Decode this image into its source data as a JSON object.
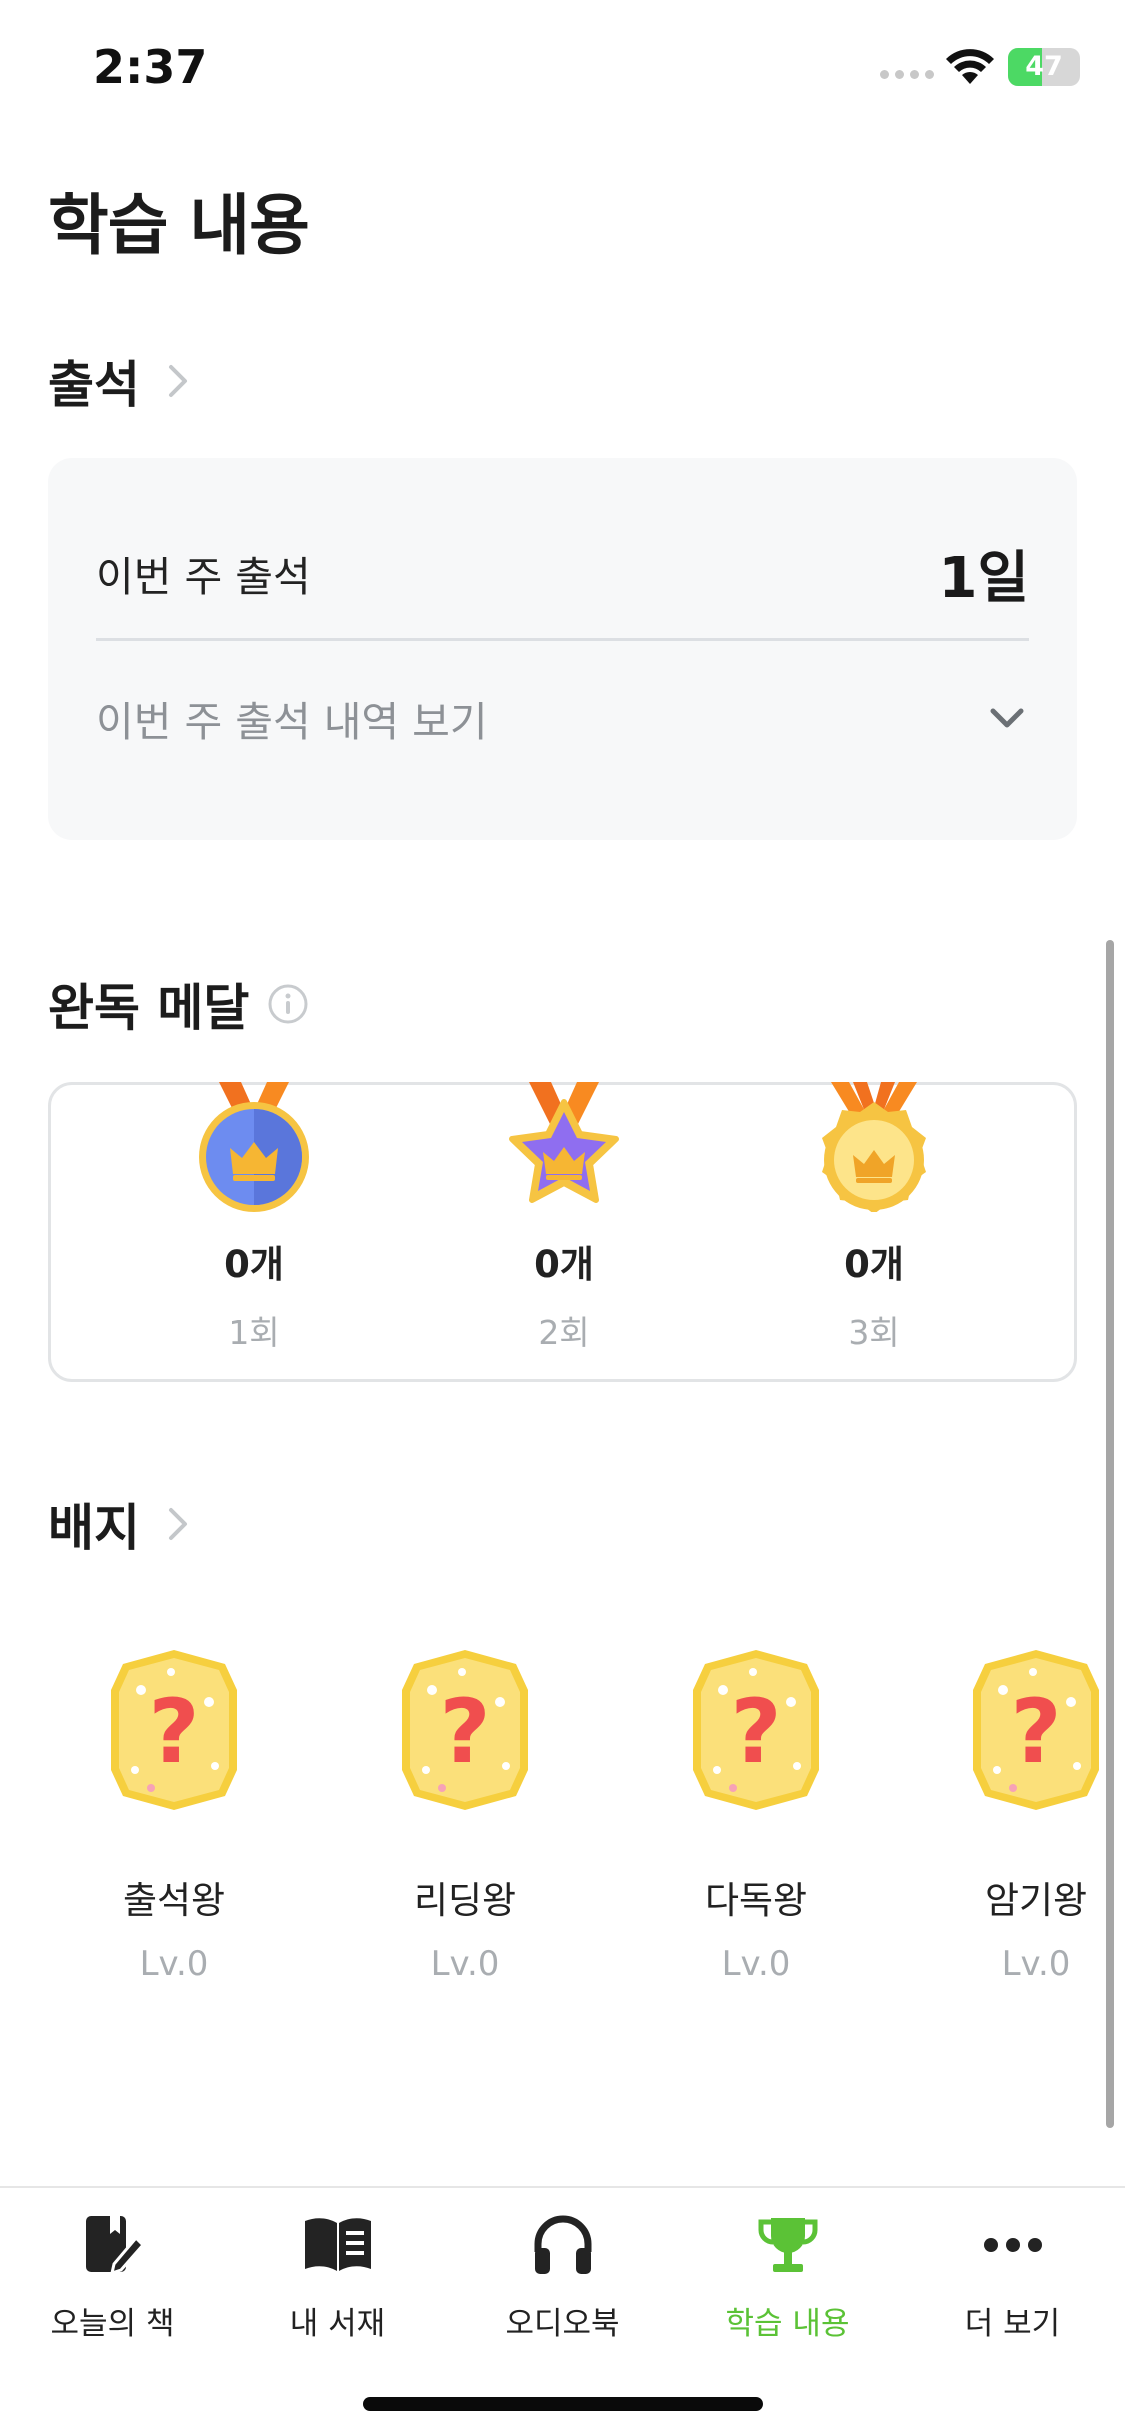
{
  "status_bar": {
    "time": "2:37",
    "battery": "47",
    "battery_level_percent": 47
  },
  "page": {
    "title": "학습 내용"
  },
  "attendance": {
    "section_title": "출석",
    "week_label": "이번 주 출석",
    "week_value": "1일",
    "history_label": "이번 주 출석 내역 보기"
  },
  "medals": {
    "section_title": "완독 메달",
    "items": [
      {
        "count": "0개",
        "label": "1회",
        "icon": "blue-crown-medal-icon"
      },
      {
        "count": "0개",
        "label": "2회",
        "icon": "purple-star-crown-medal-icon"
      },
      {
        "count": "0개",
        "label": "3회",
        "icon": "gold-crown-medal-icon"
      }
    ]
  },
  "badges": {
    "section_title": "배지",
    "items": [
      {
        "name": "출석왕",
        "level": "Lv.0"
      },
      {
        "name": "리딩왕",
        "level": "Lv.0"
      },
      {
        "name": "다독왕",
        "level": "Lv.0"
      },
      {
        "name": "암기왕",
        "level": "Lv.0"
      }
    ]
  },
  "tab_bar": {
    "active_color": "#5bc236",
    "tabs": [
      {
        "label": "오늘의 책",
        "icon": "book-pen-icon",
        "active": false
      },
      {
        "label": "내 서재",
        "icon": "open-book-icon",
        "active": false
      },
      {
        "label": "오디오북",
        "icon": "headphones-icon",
        "active": false
      },
      {
        "label": "학습 내용",
        "icon": "trophy-icon",
        "active": true
      },
      {
        "label": "더 보기",
        "icon": "more-dots-icon",
        "active": false
      }
    ]
  }
}
